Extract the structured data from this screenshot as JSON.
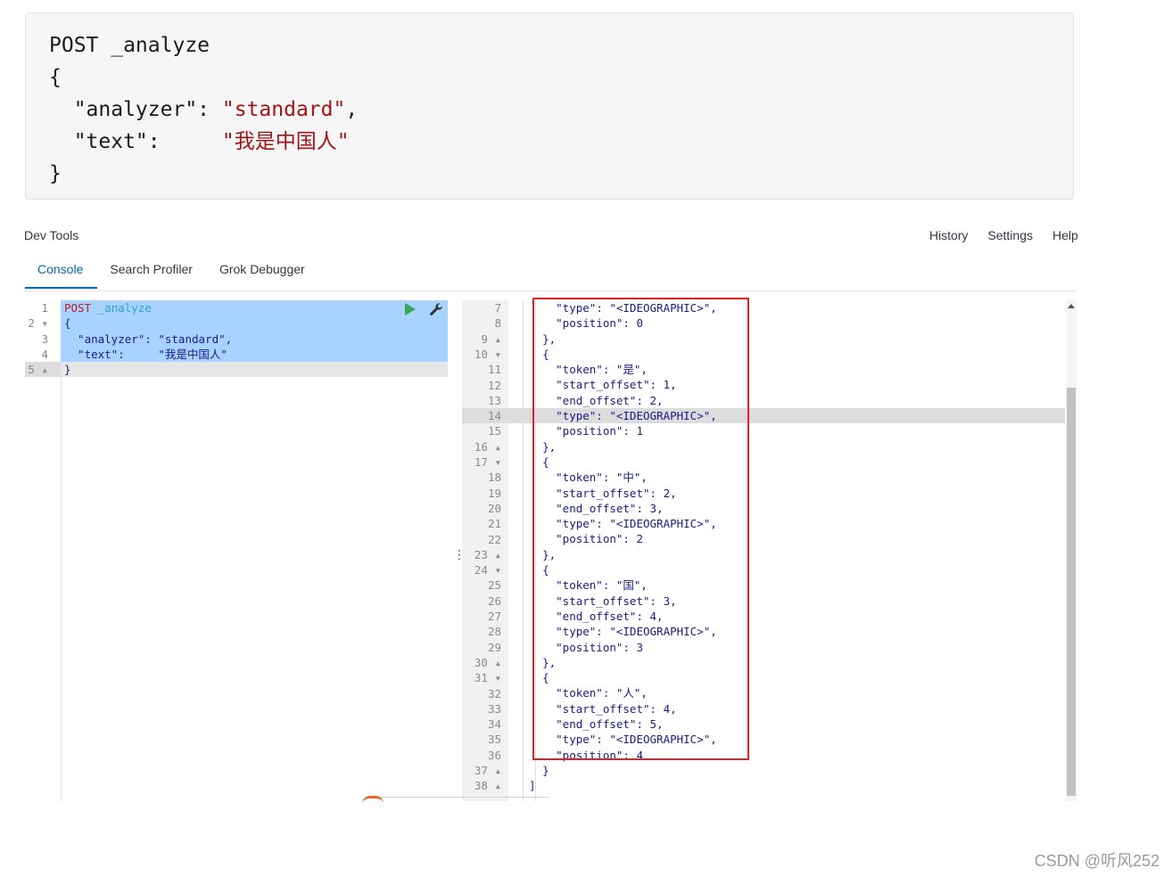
{
  "snippet": {
    "lines": [
      [
        {
          "t": "POST _analyze",
          "c": ""
        }
      ],
      [
        {
          "t": "{",
          "c": ""
        }
      ],
      [
        {
          "t": "  \"analyzer\": ",
          "c": ""
        },
        {
          "t": "\"standard\"",
          "c": "s-str"
        },
        {
          "t": ",",
          "c": ""
        }
      ],
      [
        {
          "t": "  \"text\":     ",
          "c": ""
        },
        {
          "t": "\"我是中国人\"",
          "c": "s-str"
        }
      ],
      [
        {
          "t": "}",
          "c": ""
        }
      ]
    ]
  },
  "header": {
    "title": "Dev Tools",
    "menu": {
      "history": "History",
      "settings": "Settings",
      "help": "Help"
    }
  },
  "tabs": {
    "console": "Console",
    "search_profiler": "Search Profiler",
    "grok_debugger": "Grok Debugger"
  },
  "request_editor": {
    "line_numbers": [
      "1",
      "2 ▾",
      "3",
      "4",
      "5 ▴"
    ],
    "lines": [
      [
        {
          "t": "POST",
          "c": "k-method"
        },
        {
          "t": " ",
          "c": ""
        },
        {
          "t": "_analyze",
          "c": "k-url"
        }
      ],
      [
        {
          "t": "{",
          "c": ""
        }
      ],
      [
        {
          "t": "  \"analyzer\": \"standard\",",
          "c": "k-key"
        }
      ],
      [
        {
          "t": "  \"text\":     \"我是中国人\"",
          "c": "k-key"
        }
      ],
      [
        {
          "t": "}",
          "c": ""
        }
      ]
    ]
  },
  "response_editor": {
    "line_numbers": [
      "7",
      "8",
      "9 ▴",
      "10 ▾",
      "11",
      "12",
      "13",
      "14",
      "15",
      "16 ▴",
      "17 ▾",
      "18",
      "19",
      "20",
      "21",
      "22",
      "23 ▴",
      "24 ▾",
      "25",
      "26",
      "27",
      "28",
      "29",
      "30 ▴",
      "31 ▾",
      "32",
      "33",
      "34",
      "35",
      "36",
      "37 ▴",
      "38 ▴"
    ],
    "lines": [
      "      \"type\": \"<IDEOGRAPHIC>\",",
      "      \"position\": 0",
      "    },",
      "    {",
      "      \"token\": \"是\",",
      "      \"start_offset\": 1,",
      "      \"end_offset\": 2,",
      "      \"type\": \"<IDEOGRAPHIC>\",",
      "      \"position\": 1",
      "    },",
      "    {",
      "      \"token\": \"中\",",
      "      \"start_offset\": 2,",
      "      \"end_offset\": 3,",
      "      \"type\": \"<IDEOGRAPHIC>\",",
      "      \"position\": 2",
      "    },",
      "    {",
      "      \"token\": \"国\",",
      "      \"start_offset\": 3,",
      "      \"end_offset\": 4,",
      "      \"type\": \"<IDEOGRAPHIC>\",",
      "      \"position\": 3",
      "    },",
      "    {",
      "      \"token\": \"人\",",
      "      \"start_offset\": 4,",
      "      \"end_offset\": 5,",
      "      \"type\": \"<IDEOGRAPHIC>\",",
      "      \"position\": 4",
      "    }",
      "  ]"
    ]
  },
  "colors": {
    "accent": "#006bb4",
    "run": "#35a852",
    "highlight_box": "#e02424",
    "selection": "#a8d2ff"
  },
  "icons": {
    "run": "play-icon",
    "settings": "wrench-icon"
  },
  "watermark": "CSDN @听风252"
}
